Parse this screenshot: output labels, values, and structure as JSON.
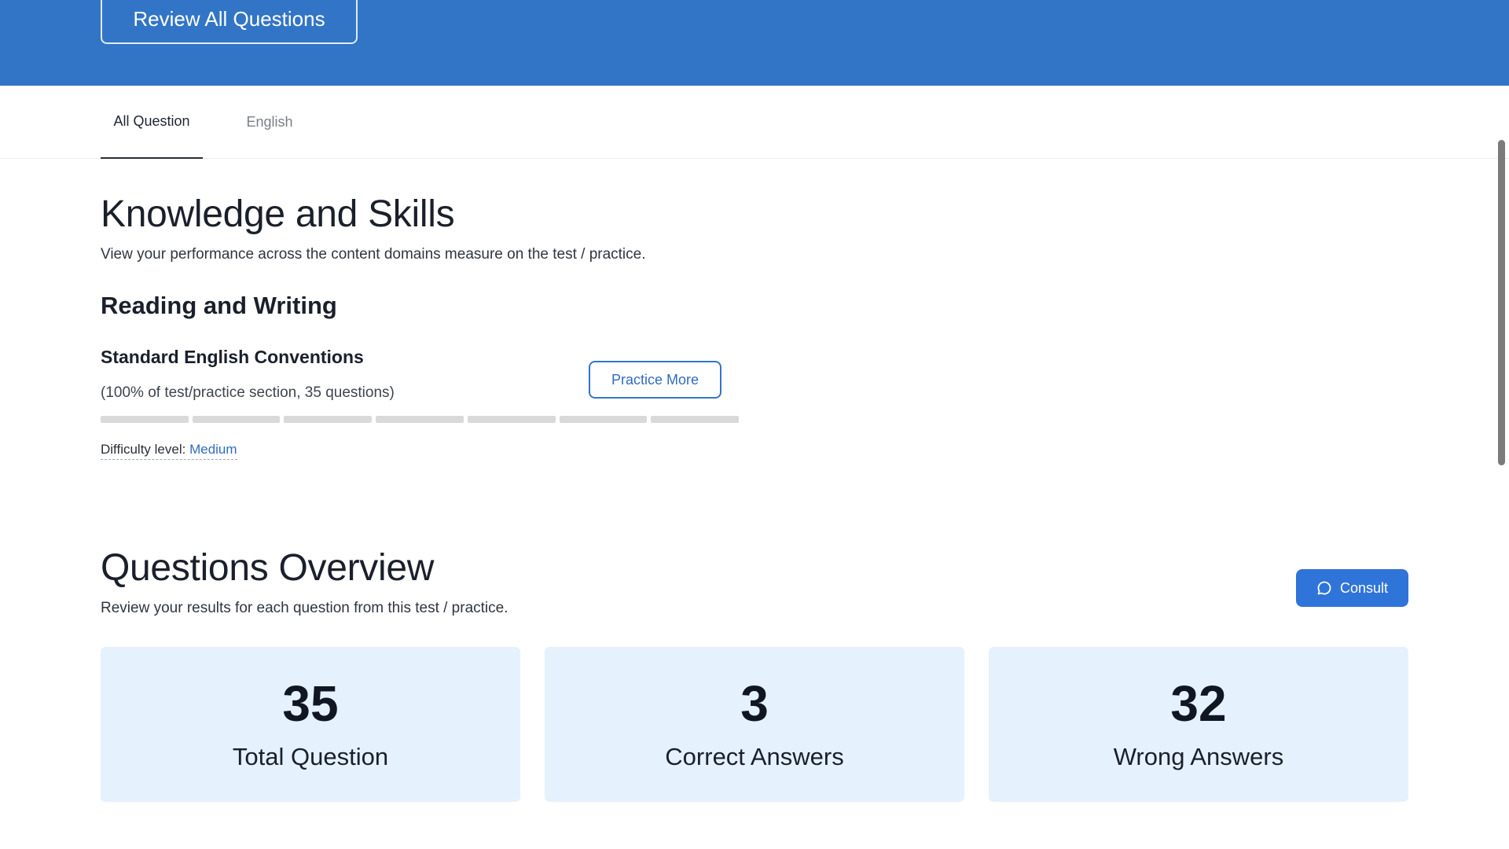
{
  "header": {
    "review_button_label": "Review All Questions"
  },
  "tabs": [
    {
      "label": "All Question",
      "active": true
    },
    {
      "label": "English",
      "active": false
    }
  ],
  "knowledge": {
    "title": "Knowledge and Skills",
    "description": "View your performance across the content domains measure on the test / practice.",
    "section_title": "Reading and Writing",
    "domain": {
      "title": "Standard English Conventions",
      "meta": "(100% of test/practice section, 35 questions)",
      "practice_button_label": "Practice More",
      "progress_segments_total": 7,
      "progress_segments_filled": 0,
      "difficulty_label": "Difficulty level:",
      "difficulty_value": "Medium"
    }
  },
  "overview": {
    "title": "Questions Overview",
    "description": "Review your results for each question from this test / practice.",
    "consult_button_label": "Consult",
    "consult_icon": "chat-bubble-icon",
    "cards": [
      {
        "value": "35",
        "label": "Total Question"
      },
      {
        "value": "3",
        "label": "Correct Answers"
      },
      {
        "value": "32",
        "label": "Wrong Answers"
      }
    ]
  },
  "colors": {
    "header_bg": "#3275c6",
    "accent": "#2f74d9",
    "card_bg": "#e5f1fd",
    "progress_empty": "#d9d9d9"
  }
}
